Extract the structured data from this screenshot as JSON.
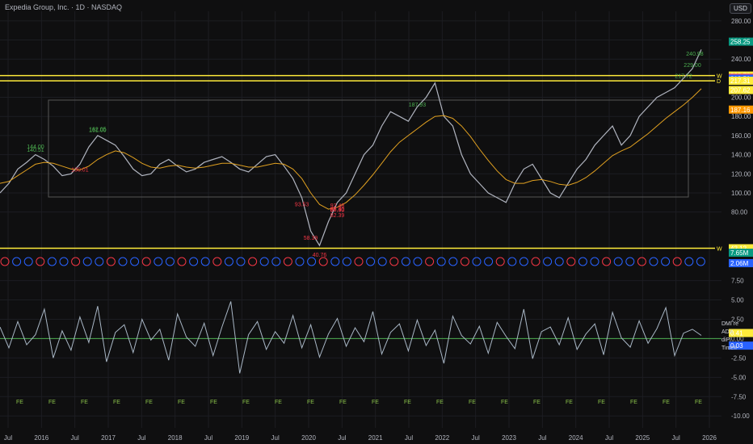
{
  "header": {
    "title": "Expedia Group, Inc. · 1D · NASDAQ",
    "currency": "USD"
  },
  "chart_data": [
    {
      "type": "line",
      "name": "price",
      "x_ticks": [
        "Jul",
        "2016",
        "Jul",
        "2017",
        "Jul",
        "2018",
        "Jul",
        "2019",
        "Jul",
        "2020",
        "Jul",
        "2021",
        "Jul",
        "2022",
        "Jul",
        "2023",
        "Jul",
        "2024",
        "Jul",
        "2025",
        "Jul",
        "2026"
      ],
      "y_ticks": [
        80,
        100,
        120,
        140,
        160,
        180,
        200,
        220,
        240,
        260,
        280
      ],
      "ylim": [
        40,
        290
      ],
      "series": [
        {
          "values": [
            100,
            110,
            125,
            132,
            140,
            135,
            128,
            118,
            120,
            130,
            148,
            160,
            155,
            150,
            138,
            125,
            118,
            120,
            130,
            135,
            128,
            122,
            125,
            132,
            135,
            138,
            132,
            125,
            122,
            130,
            138,
            140,
            128,
            115,
            95,
            60,
            45,
            70,
            90,
            100,
            120,
            140,
            150,
            170,
            185,
            180,
            175,
            190,
            200,
            215,
            180,
            170,
            140,
            120,
            110,
            100,
            95,
            90,
            110,
            125,
            130,
            115,
            100,
            95,
            110,
            125,
            135,
            150,
            160,
            170,
            150,
            160,
            180,
            190,
            200,
            205,
            210,
            220,
            230,
            250
          ]
        },
        {
          "values": [
            110,
            112,
            118,
            124,
            130,
            132,
            131,
            128,
            125,
            124,
            128,
            135,
            140,
            144,
            142,
            137,
            131,
            127,
            126,
            128,
            129,
            127,
            126,
            127,
            129,
            131,
            131,
            129,
            127,
            127,
            129,
            131,
            130,
            125,
            115,
            100,
            88,
            83,
            85,
            90,
            98,
            108,
            119,
            131,
            143,
            153,
            160,
            167,
            174,
            180,
            181,
            178,
            170,
            159,
            146,
            134,
            123,
            114,
            110,
            110,
            113,
            114,
            112,
            109,
            108,
            111,
            116,
            123,
            131,
            139,
            144,
            148,
            155,
            162,
            170,
            178,
            185,
            192,
            200,
            209
          ]
        }
      ],
      "high_labels": [
        "140.51",
        "161.00",
        "144.00",
        "187.93",
        "217.72",
        "162.05",
        "240.98",
        "229.00"
      ],
      "low_labels": [
        "88.40",
        "93.53",
        "58.39",
        "40.76",
        "87.90",
        "88.70",
        "82.39",
        "92.48",
        "130.01"
      ],
      "levels": [
        {
          "label": "W",
          "value": "222.78"
        },
        {
          "label": "D",
          "value": "217.31"
        },
        {
          "label": "W",
          "value": "42.12"
        }
      ],
      "price_tags": [
        {
          "value": "258.25",
          "color": "#089981"
        },
        {
          "value": "222.78",
          "color": "#ffeb3b"
        },
        {
          "value": "220.41",
          "color": "#f23645"
        },
        {
          "value": "219.50",
          "color": "#2962ff"
        },
        {
          "value": "217.31",
          "color": "#ffeb3b"
        },
        {
          "value": "207.62",
          "color": "#ffeb3b"
        },
        {
          "value": "187.16",
          "color": "#ff9800"
        },
        {
          "value": "42.12",
          "color": "#ffeb3b"
        }
      ],
      "volume_tags": [
        {
          "value": "7.65M",
          "color": "#089981"
        },
        {
          "value": "2.06M",
          "color": "#2962ff"
        }
      ]
    },
    {
      "type": "line",
      "name": "DMI oscillator",
      "y_ticks": [
        "7.50",
        "5.00",
        "2.50",
        "0.00",
        "-2.50",
        "-5.00",
        "-7.50",
        "-10.00"
      ],
      "ylim": [
        -10.5,
        8.5
      ],
      "values": [
        1.5,
        -1.2,
        2.2,
        -0.8,
        0.5,
        3.8,
        -2.5,
        1.0,
        -1.5,
        2.8,
        -0.5,
        4.2,
        -3.0,
        0.8,
        1.8,
        -1.8,
        2.5,
        -0.2,
        1.2,
        -2.8,
        3.2,
        0.2,
        -1.0,
        2.0,
        -2.2,
        1.5,
        4.8,
        -4.5,
        0.5,
        2.2,
        -1.4,
        0.9,
        -0.6,
        3.0,
        -1.2,
        1.8,
        -2.4,
        0.6,
        2.6,
        -1.0,
        1.4,
        -0.4,
        3.5,
        -2.0,
        0.8,
        1.9,
        -1.6,
        2.4,
        -0.9,
        1.1,
        -3.2,
        2.9,
        0.4,
        -0.7,
        1.6,
        -1.9,
        2.1,
        0.3,
        -1.3,
        3.8,
        -2.6,
        0.9,
        1.5,
        -0.8,
        2.7,
        -1.4,
        0.6,
        1.9,
        -2.1,
        3.4,
        0.1,
        -1.1,
        2.3,
        -0.6,
        1.3,
        4.0,
        -2.2,
        0.7,
        1.2,
        0.41
      ],
      "tags": [
        {
          "value": "0.41",
          "color": "#ffeb3b",
          "text_color": "#000"
        },
        {
          "value": "0.03",
          "color": "#2962ff",
          "text_color": "#fff"
        }
      ],
      "legend": [
        "DMI re",
        "ADX",
        "diPl",
        "Timefr"
      ],
      "marker_text": "FE"
    }
  ]
}
